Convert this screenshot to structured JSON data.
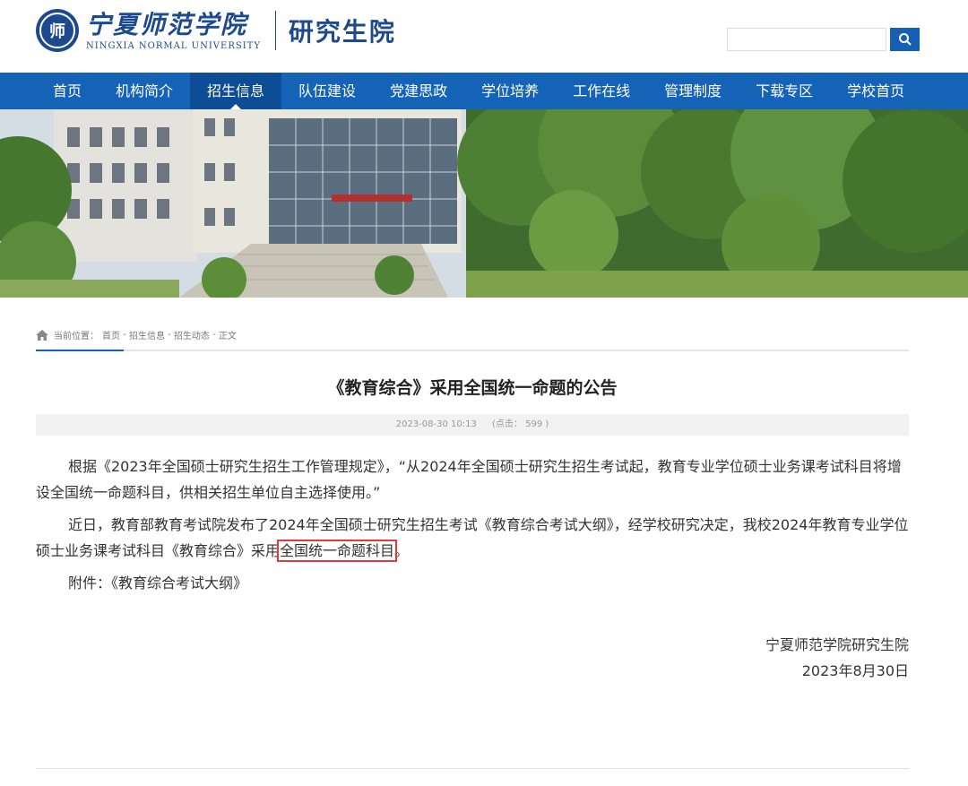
{
  "header": {
    "seal_text": "师",
    "brand_cn": "宁夏师范学院",
    "brand_en": "NINGXIA NORMAL UNIVERSITY",
    "dept": "研究生院",
    "search_placeholder": ""
  },
  "nav": {
    "items": [
      {
        "label": "首页"
      },
      {
        "label": "机构简介"
      },
      {
        "label": "招生信息"
      },
      {
        "label": "队伍建设"
      },
      {
        "label": "党建思政"
      },
      {
        "label": "学位培养"
      },
      {
        "label": "工作在线"
      },
      {
        "label": "管理制度"
      },
      {
        "label": "下载专区"
      },
      {
        "label": "学校首页"
      }
    ],
    "active_index": 2
  },
  "breadcrumb": {
    "prefix": "当前位置：",
    "items": [
      "首页",
      "招生信息",
      "招生动态",
      "正文"
    ],
    "separator": " - "
  },
  "article": {
    "title": "《教育综合》采用全国统一命题的公告",
    "date": "2023-08-30 10:13",
    "hits": "(点击： 599 )",
    "p1": "根据《2023年全国硕士研究生招生工作管理规定》，“从2024年全国硕士研究生招生考试起，教育专业学位硕士业务课考试科目将增设全国统一命题科目，供相关招生单位自主选择使用。”",
    "p2_before": "近日，教育部教育考试院发布了2024年全国硕士研究生招生考试《教育综合考试大纲》，经学校研究决定，我校2024年教育专业学位硕士业务课考试科目《教育综合》采用",
    "p2_highlight": "全国统一命题科目",
    "p2_after": "。",
    "p3": "附件：《教育综合考试大纲》",
    "sign_org": "宁夏师范学院研究生院",
    "sign_date": "2023年8月30日"
  },
  "colors": {
    "brand": "#1d4a8f",
    "nav": "#1563b6",
    "nav_active": "#0d4d95",
    "highlight_box": "#e03b3b"
  }
}
